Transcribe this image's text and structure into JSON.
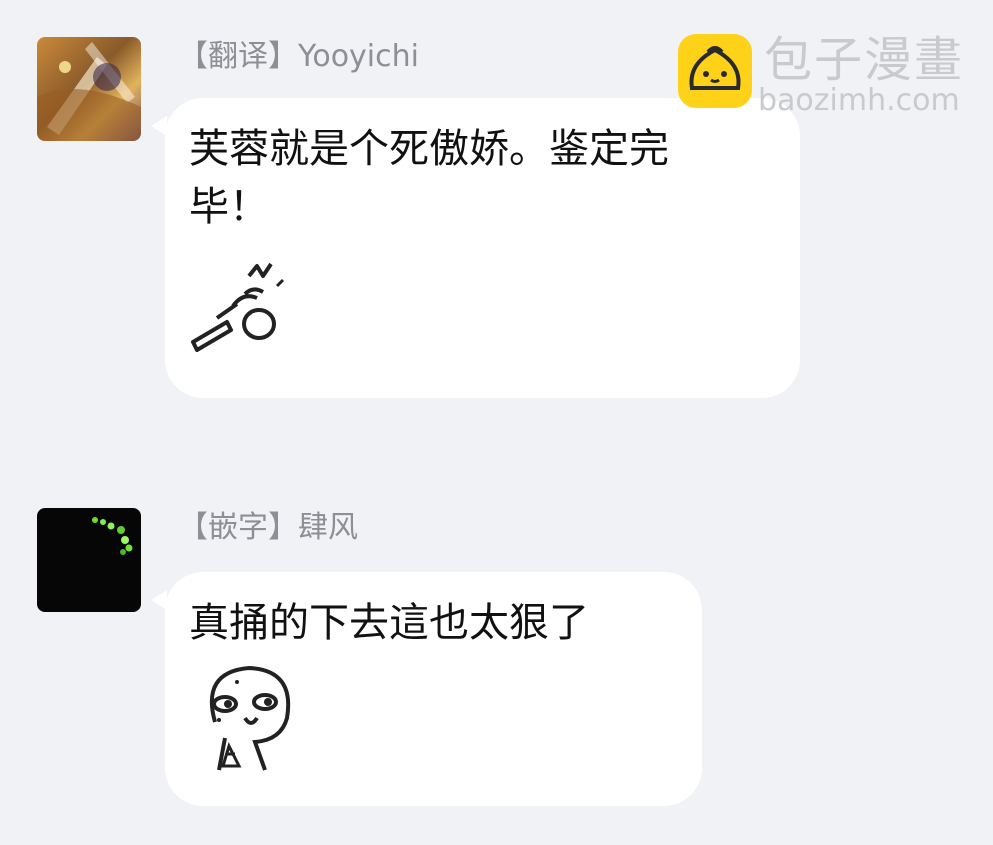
{
  "messages": [
    {
      "sender": "【翻译】Yooyichi",
      "text_line1": "芙蓉就是个死傲娇。鉴定完",
      "text_line2": "毕！",
      "sticker": "thumbs-punch-sticker"
    },
    {
      "sender": "【嵌字】肆风",
      "text_line1": "真捅的下去這也太狠了",
      "sticker": "sweating-face-sticker"
    }
  ],
  "watermark": {
    "title": "包子漫畫",
    "url": "baozimh.com",
    "logo_icon": "bun-logo-icon"
  },
  "colors": {
    "background": "#f1f2f6",
    "bubble": "#ffffff",
    "sender_text": "#8e8f94",
    "message_text": "#111111",
    "watermark_logo": "#ffd21a",
    "watermark_text": "#c9cacd"
  }
}
